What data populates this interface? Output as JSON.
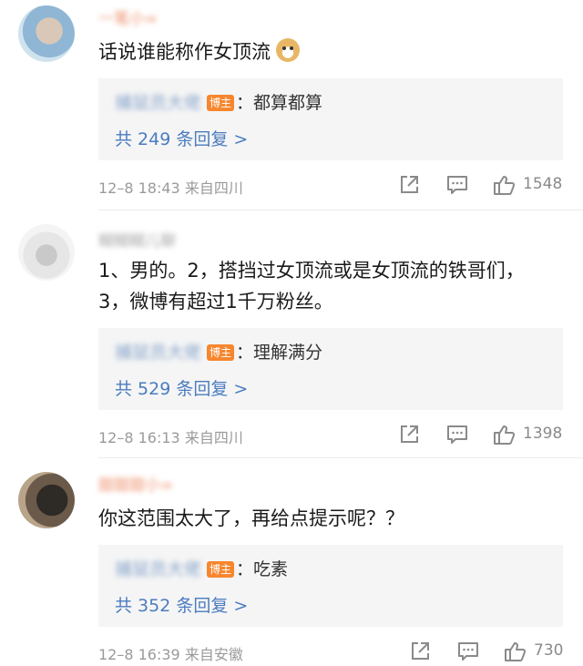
{
  "comments": [
    {
      "username": "一笔小∞",
      "text": "话说谁能称作女顶流",
      "emoji": "doge-emoji",
      "reply": {
        "user": "捕鼠员大佬",
        "badge": "博主",
        "text": "：都算都算"
      },
      "reply_count": "共 249 条回复 >",
      "meta": "12–8 18:43  来自四川",
      "likes": "1548"
    },
    {
      "username": "糊糊糊儿聊",
      "text": "1、男的。2，搭挡过女顶流或是女顶流的铁哥们，3，微博有超过1千万粉丝。",
      "reply": {
        "user": "捕鼠员大佬",
        "badge": "博主",
        "text": "：理解满分"
      },
      "reply_count": "共 529 条回复 >",
      "meta": "12–8 16:13  来自四川",
      "likes": "1398"
    },
    {
      "username": "甜甜甜小∞",
      "text": "你这范围太大了，再给点提示呢？？",
      "reply": {
        "user": "捕鼠员大佬",
        "badge": "博主",
        "text": "：吃素"
      },
      "reply_count": "共 352 条回复 >",
      "meta": "12–8 16:39  来自安徽",
      "likes": "730"
    }
  ],
  "icons": {
    "share": "share-icon",
    "comment": "comment-icon",
    "like": "like-icon"
  },
  "colors": {
    "author_badge": "#f7862e",
    "link": "#4b7cc0",
    "username": "#e86a3a"
  }
}
